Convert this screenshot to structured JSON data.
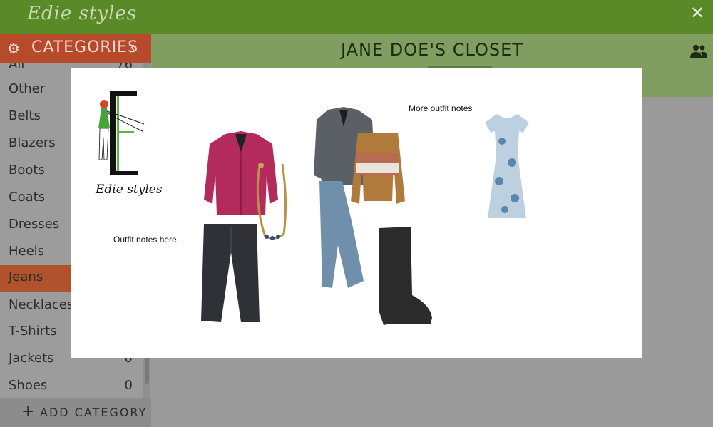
{
  "app": {
    "brand": "Edie styles",
    "close_icon": "close-icon"
  },
  "sidebar": {
    "header": "CATEGORIES",
    "items": [
      {
        "label": "All",
        "count": "76"
      },
      {
        "label": "Other",
        "count": ""
      },
      {
        "label": "Belts",
        "count": ""
      },
      {
        "label": "Blazers",
        "count": ""
      },
      {
        "label": "Boots",
        "count": ""
      },
      {
        "label": "Coats",
        "count": ""
      },
      {
        "label": "Dresses",
        "count": ""
      },
      {
        "label": "Heels",
        "count": ""
      },
      {
        "label": "Jeans",
        "count": ""
      },
      {
        "label": "Necklaces",
        "count": ""
      },
      {
        "label": "T-Shirts",
        "count": ""
      },
      {
        "label": "Jackets",
        "count": "0"
      },
      {
        "label": "Shoes",
        "count": "0"
      }
    ],
    "add_label": "ADD CATEGORY"
  },
  "main": {
    "title": "JANE DOE'S CLOSET"
  },
  "modal": {
    "logo_text": "Edie styles",
    "note_left": "Outfit notes here...",
    "note_right": "More outfit notes"
  },
  "colors": {
    "topbar": "#5a8a27",
    "header_bg": "#7f9e5f",
    "accent": "#b84a2c",
    "blazer": "#b32b5d",
    "jeans_dark": "#2f3136",
    "jeans_light": "#6f8fab",
    "sweater": "#b07a3c",
    "dress": "#9bb4c9"
  }
}
